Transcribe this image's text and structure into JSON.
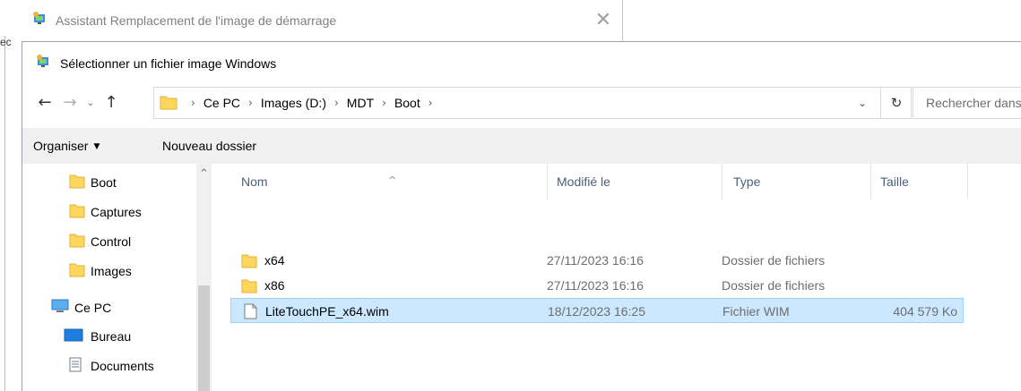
{
  "background_window": {
    "title": "Assistant Remplacement de l'image de démarrage",
    "close_glyph": "✕",
    "left_edge_text": "ec"
  },
  "dialog": {
    "title": "Sélectionner un fichier image Windows",
    "nav": {
      "back_glyph": "←",
      "forward_glyph": "→",
      "recent_glyph": "⌄",
      "up_glyph": "↑"
    },
    "address": {
      "crumbs": [
        "Ce PC",
        "Images (D:)",
        "MDT",
        "Boot"
      ],
      "separator": "›",
      "dropdown_glyph": "⌄",
      "refresh_glyph": "↻"
    },
    "search": {
      "placeholder": "Rechercher dans : Boot"
    },
    "toolbar": {
      "organize_label": "Organiser",
      "organize_caret": "▼",
      "new_folder_label": "Nouveau dossier"
    },
    "navpane": {
      "scroll_up_glyph": "^",
      "items": [
        {
          "label": "Boot",
          "icon": "folder-icon"
        },
        {
          "label": "Captures",
          "icon": "folder-icon"
        },
        {
          "label": "Control",
          "icon": "folder-icon"
        },
        {
          "label": "Images",
          "icon": "folder-icon"
        },
        {
          "label": "Ce PC",
          "icon": "computer-icon"
        },
        {
          "label": "Bureau",
          "icon": "desktop-icon"
        },
        {
          "label": "Documents",
          "icon": "documents-icon"
        }
      ]
    },
    "filelist": {
      "columns": {
        "name": "Nom",
        "modified": "Modifié le",
        "type": "Type",
        "size": "Taille"
      },
      "sort_glyph": "^",
      "rows": [
        {
          "name": "x64",
          "modified": "27/11/2023 16:16",
          "type": "Dossier de fichiers",
          "size": "",
          "icon": "folder-icon"
        },
        {
          "name": "x86",
          "modified": "27/11/2023 16:16",
          "type": "Dossier de fichiers",
          "size": "",
          "icon": "folder-icon"
        },
        {
          "name": "LiteTouchPE_x64.wim",
          "modified": "18/12/2023 16:25",
          "type": "Fichier WIM",
          "size": "404 579 Ko",
          "icon": "file-icon",
          "selected": true
        }
      ]
    }
  },
  "colors": {
    "selection_bg": "#cce8ff",
    "selection_border": "#99d1ff",
    "folder_yellow": "#ffd65c",
    "command_bar_bg": "#f0f0f0",
    "header_text": "#4c607a"
  }
}
